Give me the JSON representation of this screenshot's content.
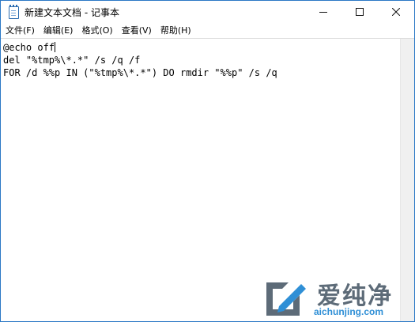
{
  "window": {
    "title": "新建文本文档 - 记事本"
  },
  "menu": [
    {
      "label": "文件(F)"
    },
    {
      "label": "编辑(E)"
    },
    {
      "label": "格式(O)"
    },
    {
      "label": "查看(V)"
    },
    {
      "label": "帮助(H)"
    }
  ],
  "editor": {
    "lines": [
      "@echo off",
      "del \"%tmp%\\*.*\" /s /q /f",
      "FOR /d %%p IN (\"%tmp%\\*.*\") DO rmdir \"%%p\" /s /q"
    ]
  },
  "watermark": {
    "brand_cn": "爱纯净",
    "brand_en": "aichunjing.com"
  },
  "icons": {
    "app": "notepad-icon",
    "minimize": "minimize-icon",
    "maximize": "maximize-icon",
    "close": "close-icon"
  }
}
